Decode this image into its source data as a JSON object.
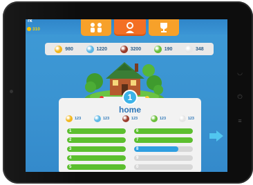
{
  "header": {
    "title_stub": "rk",
    "coins": "310",
    "tabs": [
      {
        "icon": "people-icon",
        "glyph": "♚♚",
        "active": false
      },
      {
        "icon": "person-icon",
        "glyph": "♛",
        "active": true
      },
      {
        "icon": "trophy-icon",
        "glyph": "🏆",
        "active": false
      }
    ]
  },
  "resources": [
    {
      "name": "gold",
      "value": "980",
      "color": "#f2b61c"
    },
    {
      "name": "water",
      "value": "1220",
      "color": "#5fb8e6"
    },
    {
      "name": "wood",
      "value": "3200",
      "color": "#9a3b2a"
    },
    {
      "name": "leaf",
      "value": "190",
      "color": "#6bbf3a"
    },
    {
      "name": "stone",
      "value": "348",
      "color": "#e6e6e6"
    }
  ],
  "building": {
    "level": "1",
    "name": "home",
    "requirements": [
      {
        "name": "gold",
        "value": "123",
        "color": "#f2b61c"
      },
      {
        "name": "water",
        "value": "123",
        "color": "#5fb8e6"
      },
      {
        "name": "wood",
        "value": "123",
        "color": "#9a3b2a"
      },
      {
        "name": "leaf",
        "value": "123",
        "color": "#6bbf3a"
      },
      {
        "name": "stone",
        "value": "123",
        "color": "#e6e6e6"
      }
    ],
    "levels_left": [
      {
        "num": "1",
        "progress": 1.0
      },
      {
        "num": "2",
        "progress": 1.0
      },
      {
        "num": "3",
        "progress": 1.0
      },
      {
        "num": "4",
        "progress": 1.0
      },
      {
        "num": "5",
        "progress": 1.0
      }
    ],
    "levels_right": [
      {
        "num": "6",
        "progress": 1.0
      },
      {
        "num": "7",
        "progress": 1.0
      },
      {
        "num": "8",
        "progress": 0.75
      },
      {
        "num": "9",
        "progress": 0.0
      },
      {
        "num": "0",
        "progress": 0.0
      }
    ]
  },
  "colors": {
    "complete": "#5cbf2f",
    "in_progress": "#2f9fe0",
    "empty": "#d7d7d7"
  },
  "nav": {
    "next_icon": "arrow-right-icon"
  }
}
